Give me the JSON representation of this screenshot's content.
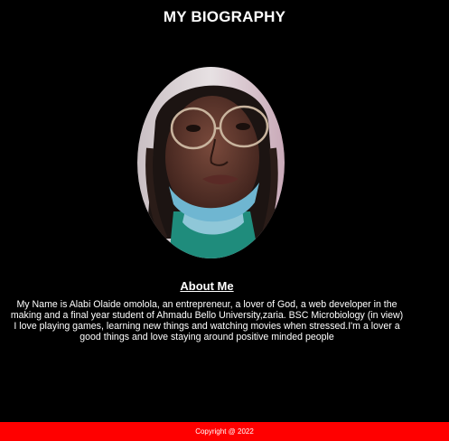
{
  "header": {
    "title": "MY BIOGRAPHY"
  },
  "portrait": {
    "shape": "oval"
  },
  "about": {
    "heading": "About Me",
    "paragraph_1": "My Name is Alabi Olaide omolola, an entrepreneur, a lover of God, a web developer in the making and a final year student of Ahmadu Bello University,zaria. BSC Microbiology (in view)",
    "paragraph_2": "I love playing games, learning new things and watching movies when stressed.I'm a lover a good things and love staying around positive minded people"
  },
  "footer": {
    "text": "Copyright @ 2022"
  },
  "colors": {
    "background": "#000000",
    "text": "#ffffff",
    "footer_bg": "#ff0000"
  }
}
